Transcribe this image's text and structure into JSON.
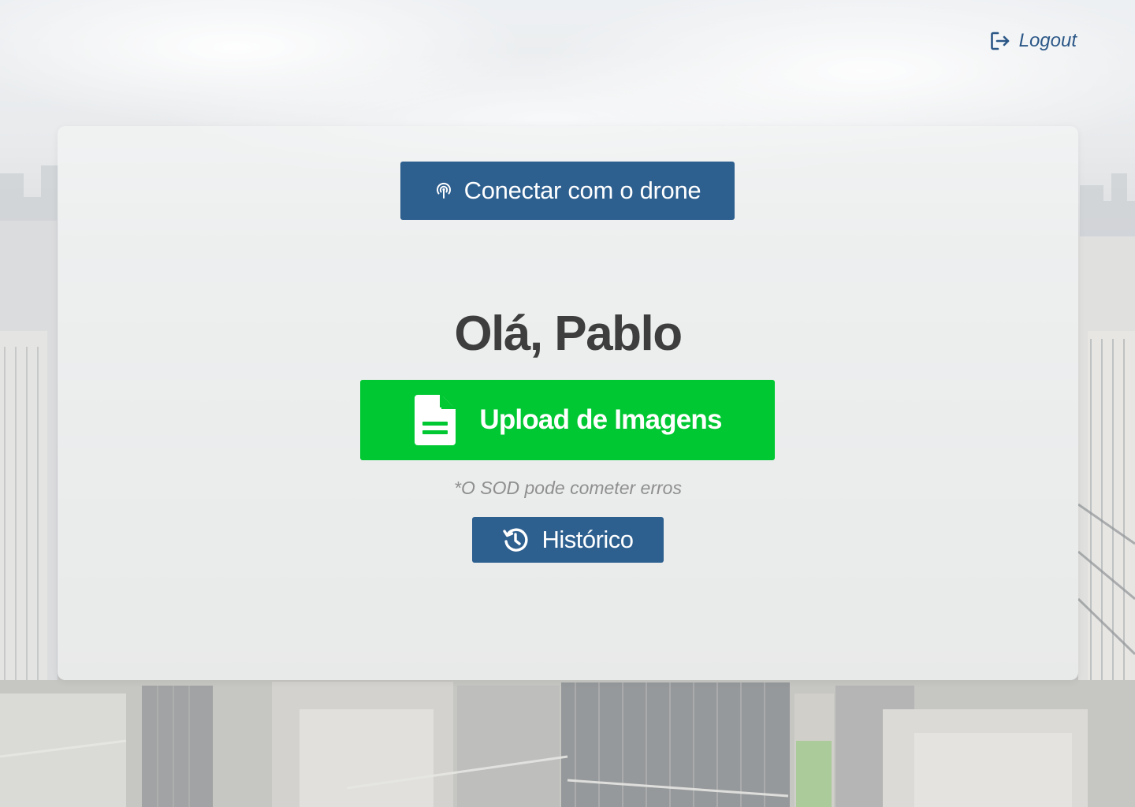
{
  "header": {
    "logout_label": "Logout",
    "logout_icon": "logout-icon"
  },
  "main": {
    "connect_button": {
      "label": "Conectar com o drone",
      "icon": "signal-broadcast-icon"
    },
    "greeting": "Olá, Pablo",
    "upload_button": {
      "label": "Upload de Imagens",
      "icon": "file-text-icon"
    },
    "disclaimer": "*O SOD pode cometer erros",
    "history_button": {
      "label": "Histórico",
      "icon": "history-icon"
    }
  },
  "colors": {
    "primary_blue": "#2d5f8f",
    "upload_green": "#00c832",
    "greeting_text": "#3e3e3e",
    "disclaimer_text": "#8f8f8f",
    "logout_text": "#2b5787"
  }
}
